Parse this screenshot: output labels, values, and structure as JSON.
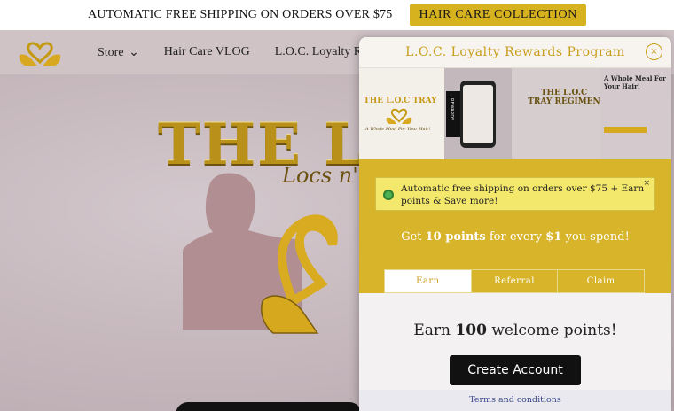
{
  "announcement": {
    "message": "AUTOMATIC FREE SHIPPING ON ORDERS OVER $75",
    "cta_label": "HAIR CARE COLLECTION"
  },
  "nav": {
    "items": [
      {
        "label": "Store",
        "has_dropdown": true
      },
      {
        "label": "Hair Care VLOG"
      },
      {
        "label": "L.O.C. Loyalty Rewards"
      }
    ]
  },
  "hero": {
    "title": "THE L.O.C",
    "script": "Locs n' C"
  },
  "popup": {
    "title": "L.O.C. Loyalty Rewards Program",
    "close_glyph": "×",
    "banner": {
      "tray_title": "THE L.O.C TRAY",
      "tray_sub": "A Whole Meal For Your Hair!",
      "rewards_tag": "REWARDS",
      "regimen": "THE L.O.C TRAY REGIMEN",
      "meal_heading": "A Whole Meal For Your Hair!"
    },
    "notice": {
      "text": "Automatic free shipping on orders over $75 + Earn points & Save more!",
      "close_glyph": "×"
    },
    "earn_rate": {
      "prefix": "Get ",
      "points": "10 points",
      "suffix": " for every ",
      "amount": "$1",
      "tail": " you spend!"
    },
    "tabs": [
      {
        "label": "Earn",
        "active": true
      },
      {
        "label": "Referral",
        "active": false
      },
      {
        "label": "Claim",
        "active": false
      }
    ],
    "welcome": {
      "prefix": "Earn ",
      "points": "100",
      "suffix": " welcome points!"
    },
    "create_button": "Create Account",
    "terms_link": "Terms and conditions"
  },
  "colors": {
    "gold": "#d7b42a",
    "gold_text": "#c79d18",
    "header_bg": "#cfc3c6",
    "button_black": "#111111"
  }
}
